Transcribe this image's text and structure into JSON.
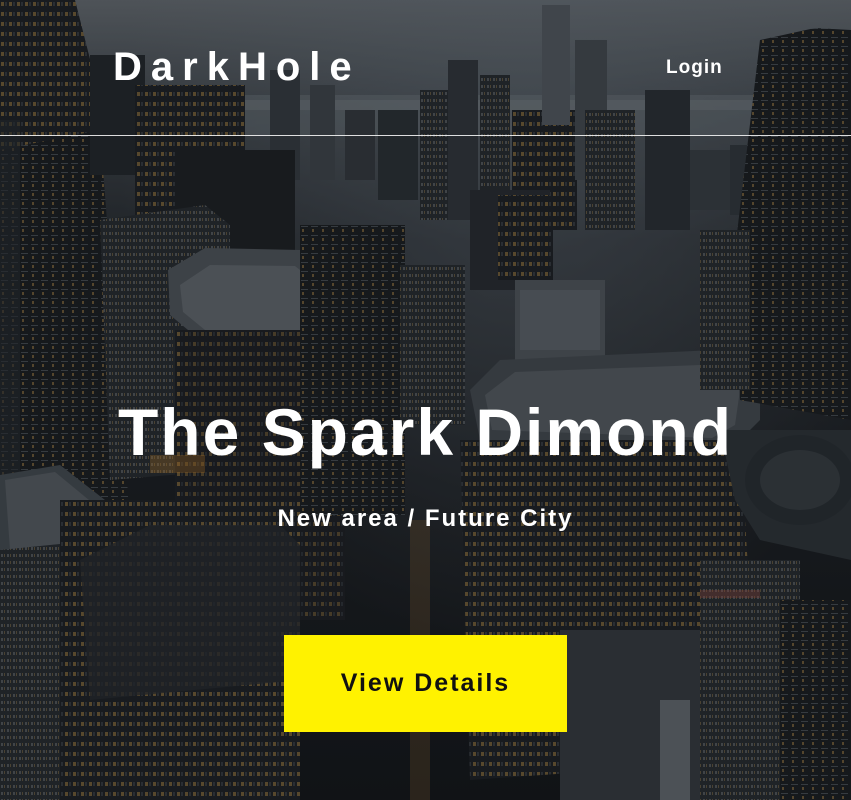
{
  "header": {
    "brand": "DarkHole",
    "login_label": "Login"
  },
  "hero": {
    "title": "The Spark Dimond",
    "subtitle": "New area / Future City",
    "cta_label": "View Details"
  },
  "colors": {
    "accent": "#fff200",
    "text": "#ffffff",
    "button_text": "#111111"
  },
  "background": {
    "subject": "aerial-city-skyline-photo"
  }
}
